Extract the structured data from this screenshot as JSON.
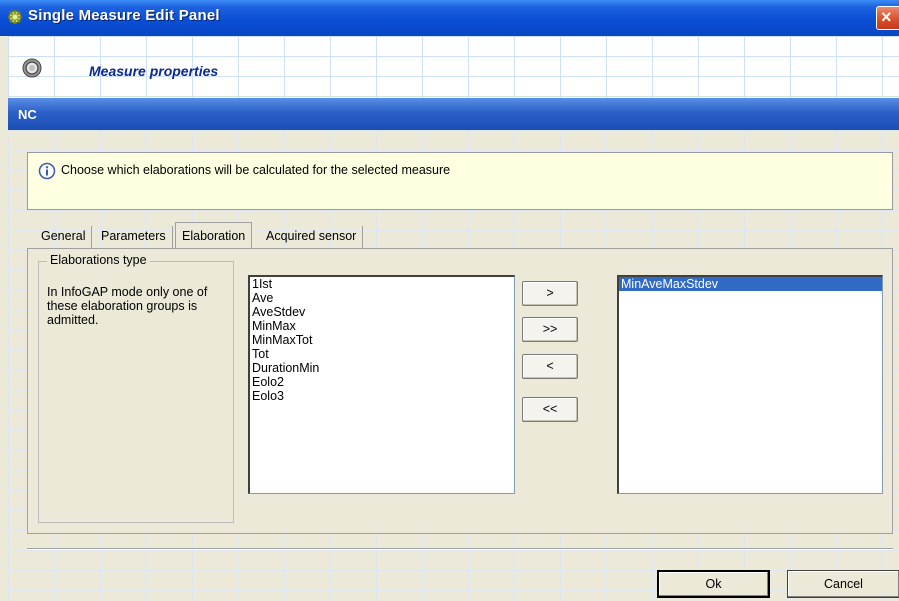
{
  "window": {
    "title": "Single Measure Edit Panel"
  },
  "header": {
    "title": "Measure properties"
  },
  "banner": {
    "label": "NC"
  },
  "info": {
    "text": "Choose which elaborations will be calculated for the selected measure"
  },
  "tabs": [
    {
      "label": "General",
      "active": false
    },
    {
      "label": "Parameters",
      "active": false
    },
    {
      "label": "Elaboration",
      "active": true
    },
    {
      "label": "Acquired sensor",
      "active": false
    }
  ],
  "elaboration": {
    "group_title": "Elaborations type",
    "group_text": "In InfoGAP mode only one of these elaboration groups is admitted.",
    "available": [
      "1Ist",
      "Ave",
      "AveStdev",
      "MinMax",
      "MinMaxTot",
      "Tot",
      "DurationMin",
      "Eolo2",
      "Eolo3"
    ],
    "selected": [
      "MinAveMaxStdev"
    ],
    "buttons": {
      "add": ">",
      "add_all": ">>",
      "remove": "<",
      "remove_all": "<<"
    }
  },
  "footer": {
    "ok_label": "Ok",
    "cancel_label": "Cancel"
  },
  "colors": {
    "title_bar": "#0a4fd6",
    "banner": "#2a60c8",
    "selection": "#316ac5",
    "info_background": "#ffffe1",
    "header_title": "#0a2896"
  },
  "icons": {
    "app": "app-icon",
    "header": "gear-icon",
    "info": "info-icon",
    "close": "close-icon"
  }
}
